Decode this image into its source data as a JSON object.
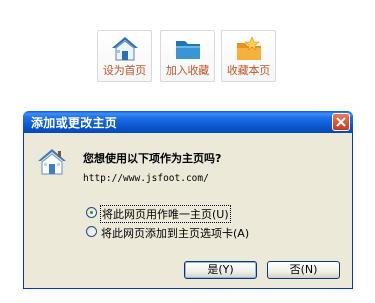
{
  "toolbar": {
    "items": [
      {
        "label": "设为首页",
        "icon": "home-icon"
      },
      {
        "label": "加入收藏",
        "icon": "folder-icon"
      },
      {
        "label": "收藏本页",
        "icon": "bookmark-folder-icon"
      }
    ]
  },
  "dialog": {
    "title": "添加或更改主页",
    "question": "您想使用以下项作为主页吗?",
    "url": "http://www.jsfoot.com/",
    "options": [
      {
        "label": "将此网页用作唯一主页(U)",
        "selected": true
      },
      {
        "label": "将此网页添加到主页选项卡(A)",
        "selected": false
      }
    ],
    "yes_label": "是(Y)",
    "no_label": "否(N)"
  },
  "colors": {
    "label_orange": "#c0582c",
    "titlebar_blue": "#0a57d0",
    "dialog_bg": "#ece9d8",
    "close_red": "#c43b1b"
  }
}
